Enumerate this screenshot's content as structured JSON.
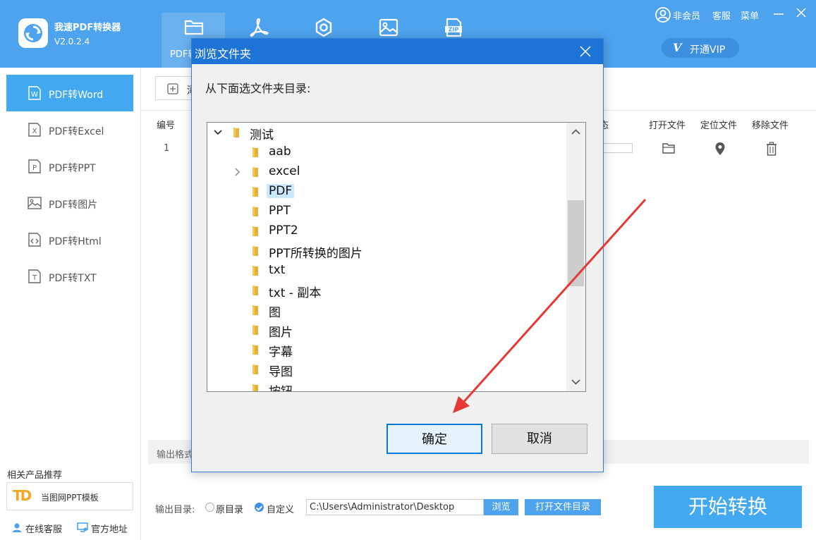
{
  "app": {
    "name": "我速PDF转换器",
    "version": "V2.0.2.4"
  },
  "header": {
    "tabs": [
      {
        "label": "PDF转",
        "icon": "folder-icon"
      },
      {
        "label": "",
        "icon": "pdf-icon"
      },
      {
        "label": "",
        "icon": "settings-icon"
      },
      {
        "label": "",
        "icon": "image-icon"
      },
      {
        "label": "",
        "icon": "zip-icon"
      }
    ],
    "user_label": "非会员",
    "service_label": "客服",
    "menu_label": "菜单",
    "vip_mark": "V",
    "vip_label": "开通VIP"
  },
  "sidebar": {
    "items": [
      {
        "label": "PDF转Word",
        "icon": "word-icon"
      },
      {
        "label": "PDF转Excel",
        "icon": "excel-icon"
      },
      {
        "label": "PDF转PPT",
        "icon": "ppt-icon"
      },
      {
        "label": "PDF转图片",
        "icon": "picture-icon"
      },
      {
        "label": "PDF转Html",
        "icon": "html-icon"
      },
      {
        "label": "PDF转TXT",
        "icon": "txt-icon"
      }
    ],
    "related_title": "相关产品推荐",
    "promo_logo": "TD",
    "promo_label": "当图网PPT模板",
    "online_service": "在线客服",
    "official_site": "官方地址"
  },
  "main": {
    "add_button_label": "添",
    "table": {
      "headers": {
        "number": "编号",
        "status": "态",
        "open_file": "打开文件",
        "locate_file": "定位文件",
        "remove_file": "移除文件"
      },
      "rows": [
        {
          "number": "1"
        }
      ]
    },
    "format_label": "输出格式",
    "output_dir_label": "输出目录:",
    "option_original": "原目录",
    "option_custom": "自定义",
    "output_path": "C:\\Users\\Administrator\\Desktop",
    "browse_label": "浏览",
    "open_dir_label": "打开文件目录",
    "start_label": "开始转换"
  },
  "dialog": {
    "title": "浏览文件夹",
    "instruction": "从下面选文件夹目录:",
    "tree": {
      "root": "测试",
      "children": [
        "aab",
        "excel",
        "PDF",
        "PPT",
        "PPT2",
        "PPT所转换的图片",
        "txt",
        "txt - 副本",
        "图",
        "图片",
        "字幕",
        "导图",
        "按钮"
      ],
      "selected": "PDF"
    },
    "ok_label": "确定",
    "cancel_label": "取消"
  },
  "colors": {
    "header_bg": "#4ea3ee",
    "accent": "#42a9f0",
    "dialog_title_bg": "#1e74d6",
    "annotation_arrow": "#e53935"
  }
}
